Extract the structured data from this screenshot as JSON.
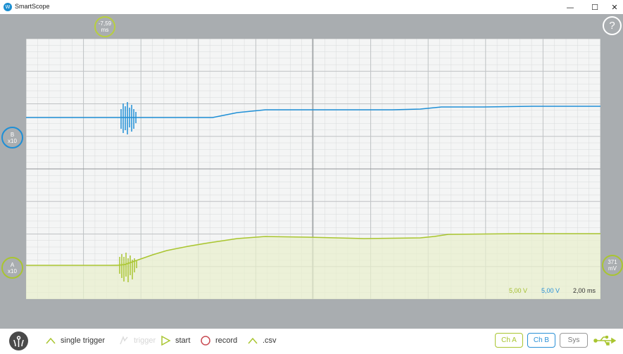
{
  "window": {
    "title": "SmartScope",
    "app_icon_glyph": "W"
  },
  "markers": {
    "time_offset_value": "-7,59",
    "time_offset_unit": "ms",
    "channel_b_label": "B",
    "channel_b_probe": "x10",
    "channel_a_label": "A",
    "channel_a_probe": "x10",
    "trigger_level_value": "371",
    "trigger_level_unit": "mV",
    "help_label": "?"
  },
  "scales": {
    "channel_a_volts_per_div": "5,00 V",
    "channel_b_volts_per_div": "5,00 V",
    "time_per_div": "2,00 ms"
  },
  "toolbar": {
    "single_trigger_label": "single trigger",
    "trigger_label": "trigger",
    "start_label": "start",
    "record_label": "record",
    "csv_label": ".csv",
    "ch_a_label": "Ch A",
    "ch_b_label": "Ch B",
    "sys_label": "Sys"
  },
  "colors": {
    "channel_a": "#a9c530",
    "channel_b": "#1e8fd6",
    "grid_background": "#f4f5f5",
    "frame": "#a9adb0"
  },
  "icons": [
    "smartscope-logo-icon",
    "minimize-icon",
    "maximize-icon",
    "close-icon",
    "help-icon",
    "single-trigger-icon",
    "trigger-icon",
    "start-play-icon",
    "record-icon",
    "csv-icon",
    "usb-icon"
  ]
}
